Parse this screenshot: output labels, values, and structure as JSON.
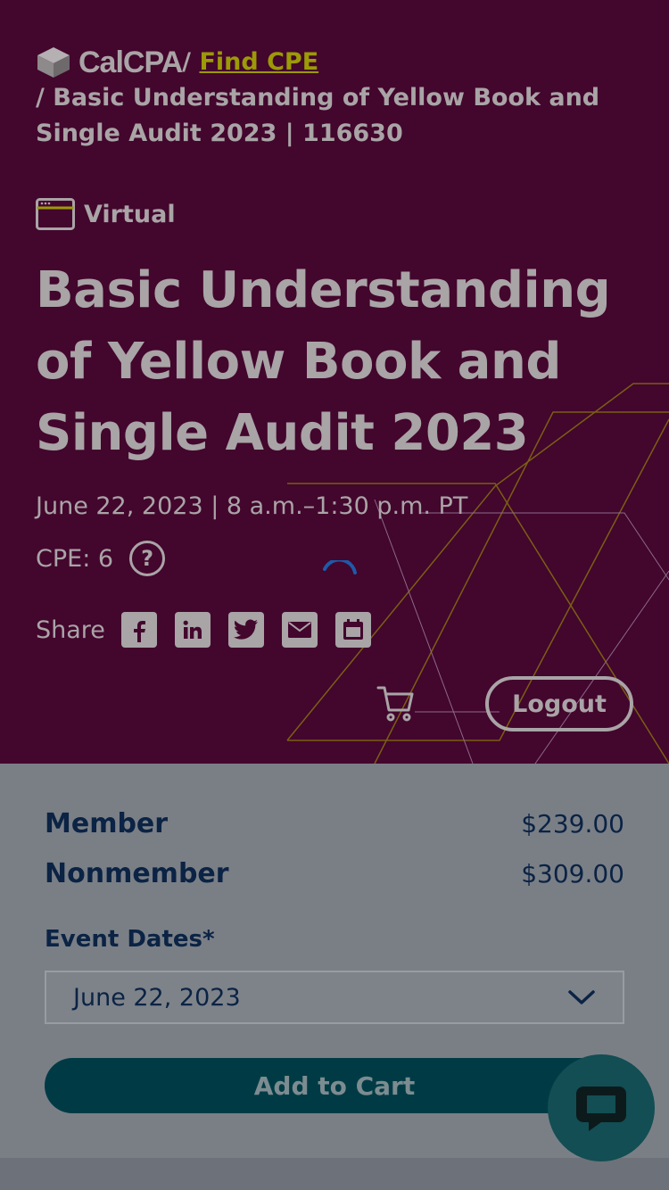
{
  "breadcrumb": {
    "brand": "CalCPA",
    "separator": "/",
    "link": "Find CPE",
    "current": "/ Basic Understanding of Yellow Book and Single Audit 2023 | 116630"
  },
  "event": {
    "format": "Virtual",
    "title": "Basic Understanding of Yellow Book and Single Audit 2023",
    "date_time": "June 22, 2023 | 8 a.m.–1:30 p.m. PT",
    "cpe": "CPE: 6",
    "help_glyph": "?"
  },
  "share": {
    "label": "Share",
    "icons": [
      "facebook-icon",
      "linkedin-icon",
      "twitter-icon",
      "email-icon",
      "calendar-icon"
    ]
  },
  "header_actions": {
    "logout": "Logout"
  },
  "pricing": {
    "rows": [
      {
        "label": "Member",
        "price": "$239.00"
      },
      {
        "label": "Nonmember",
        "price": "$309.00"
      }
    ]
  },
  "event_dates": {
    "label": "Event Dates*",
    "selected": "June 22, 2023"
  },
  "add_to_cart": "Add to Cart",
  "colors": {
    "hero_bg": "#43062d",
    "panel_bg": "#7a7f86",
    "link_accent": "#9c9a06",
    "primary_button": "#003b45",
    "text_navy": "#0b2344"
  }
}
